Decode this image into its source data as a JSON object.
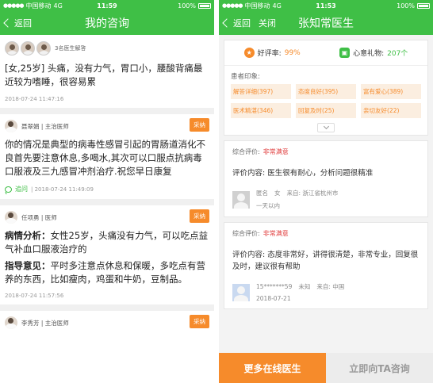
{
  "left": {
    "status": {
      "carrier": "中国移动",
      "network": "4G",
      "time": "11:59",
      "battery": "100%"
    },
    "nav": {
      "back_label": "返回",
      "title": "我的咨询"
    },
    "question": {
      "avatar_note": "3名医生解答",
      "text": "[女,25岁] 头痛，没有力气，胃口小，腰酸背痛最近较为嗜睡，很容易累",
      "time": "2018-07-24 11:47:16"
    },
    "answers": [
      {
        "doctor": "聂翠娟 | 主治医师",
        "adopt_label": "采纳",
        "text": "你的情况是典型的病毒性感冒引起的胃肠道消化不良首先要注意休息,多喝水,其次可以口服点抗病毒口服液及三九感冒冲剂治疗.祝您早日康复",
        "followup_label": "追问",
        "time": "| 2018-07-24 11:49:09"
      },
      {
        "doctor": "任项勇 | 医师",
        "adopt_label": "采纳",
        "analysis_label": "病情分析：",
        "analysis": "女性25岁，头痛没有力气，可以吃点益气补血口服液治疗的",
        "advice_label": "指导意见：",
        "advice": "平时多注意点休息和保暖，多吃点有营养的东西，比如瘦肉，鸡蛋和牛奶，豆制品。",
        "time": "2018-07-24 11:57:56"
      },
      {
        "doctor": "李秀芳 | 主治医师",
        "adopt_label": "采纳"
      }
    ]
  },
  "right": {
    "status": {
      "carrier": "中国移动",
      "network": "4G",
      "time": "11:53",
      "battery": "100%"
    },
    "nav": {
      "back_label": "返回",
      "close_label": "关闭",
      "title": "张知常医生"
    },
    "stats": {
      "rating_label": "好评率:",
      "rating_value": "99%",
      "gifts_label": "心意礼物:",
      "gifts_value": "207个"
    },
    "impression_title": "患者印象:",
    "tags": [
      "解答详细(397)",
      "态度良好(395)",
      "富有爱心(389)",
      "医术精湛(346)",
      "回复及时(25)",
      "亲切友好(22)"
    ],
    "reviews": [
      {
        "overall_label": "综合评价:",
        "overall_value": "非常满意",
        "content": "评价内容: 医生很有耐心，分析问题很精准",
        "user": "匿名",
        "gender": "女",
        "from": "来自: 浙江省杭州市",
        "when": "一天以内"
      },
      {
        "overall_label": "综合评价:",
        "overall_value": "非常满意",
        "content": "评价内容: 态度非常好，讲得很清楚，非常专业，回复很及时，建议很有帮助",
        "user": "15*******59",
        "gender": "未知",
        "from": "来自: 中国",
        "when": "2018-07-21"
      }
    ],
    "bottom": {
      "more_label": "更多在线医生",
      "consult_label": "立即向TA咨询"
    }
  },
  "colors": {
    "brand_green": "#3fbf46",
    "accent_orange": "#f68b2b",
    "satisfied_red": "#e03c3c"
  }
}
